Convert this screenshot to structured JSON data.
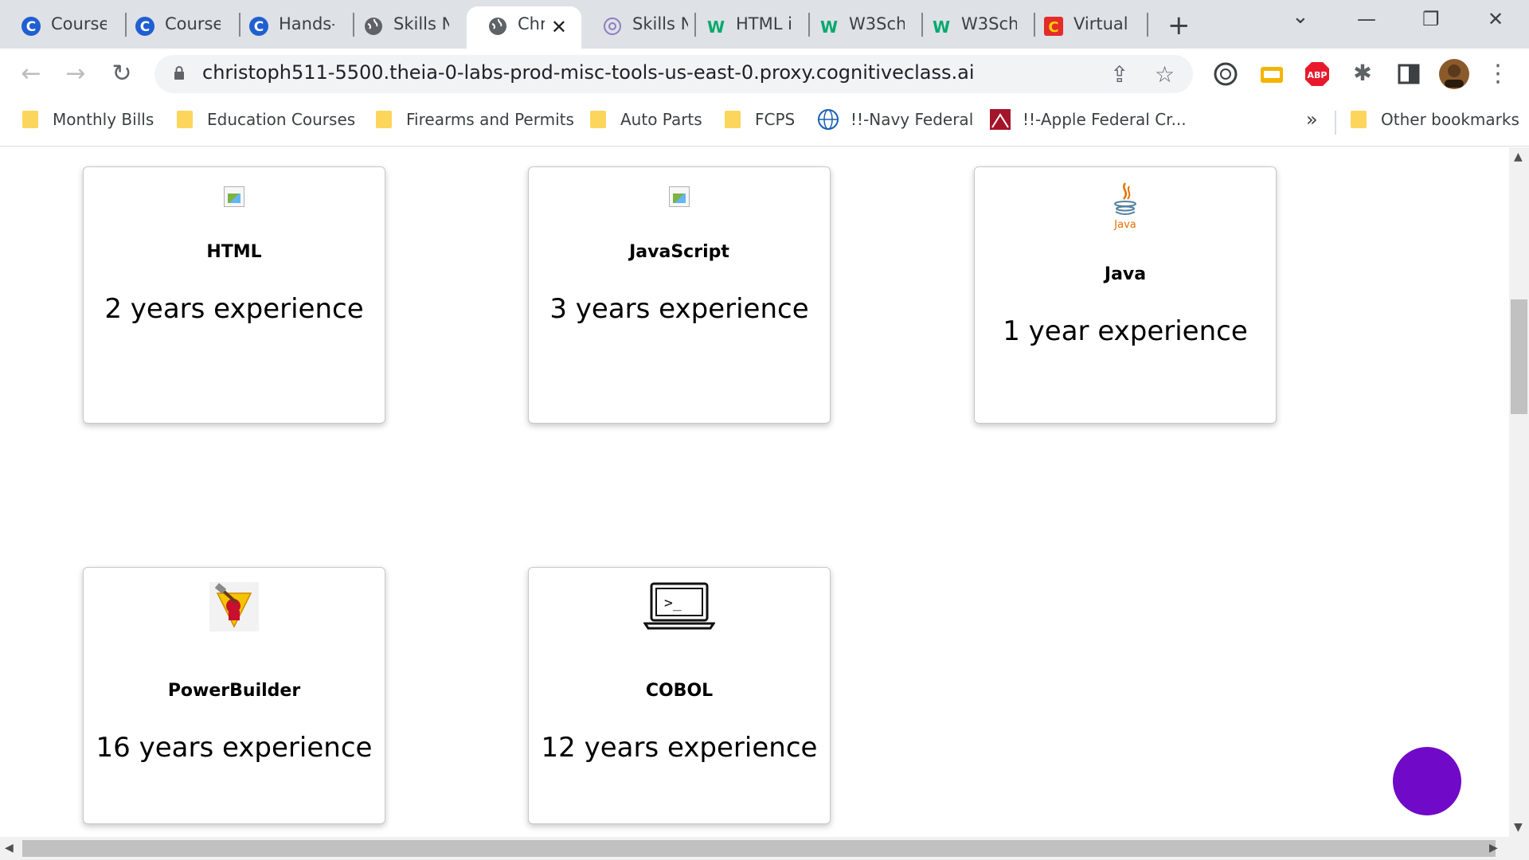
{
  "browser": {
    "tabs": [
      {
        "label": "Courser",
        "favicon": "coursera-icon",
        "color": "#1f5fd1"
      },
      {
        "label": "Courser",
        "favicon": "coursera-icon",
        "color": "#1f5fd1"
      },
      {
        "label": "Hands-",
        "favicon": "coursera-icon",
        "color": "#1f5fd1"
      },
      {
        "label": "Skills N",
        "favicon": "globe-icon",
        "color": "#5f6368"
      },
      {
        "label": "Chr",
        "favicon": "globe-icon",
        "color": "#5f6368",
        "active": true
      },
      {
        "label": "Skills N",
        "favicon": "gear-icon",
        "color": "#8e7cc3"
      },
      {
        "label": "HTML i",
        "favicon": "w3schools-icon",
        "color": "#04aa6d"
      },
      {
        "label": "W3Sch",
        "favicon": "w3schools-icon",
        "color": "#04aa6d"
      },
      {
        "label": "W3Sch",
        "favicon": "w3schools-icon",
        "color": "#04aa6d"
      },
      {
        "label": "Virtual",
        "favicon": "cognitiveclass-icon",
        "color": "#e52b2b"
      }
    ],
    "close_tab_glyph": "✕",
    "new_tab_glyph": "+",
    "window_controls": {
      "tab_search": "⌄",
      "minimize": "—",
      "restore": "❐",
      "close": "✕"
    },
    "nav": {
      "back": "←",
      "forward": "→",
      "reload": "↻"
    },
    "url": "christoph511-5500.theia-0-labs-prod-misc-tools-us-east-0.proxy.cognitiveclass.ai",
    "omnibox_icons": {
      "share": "⇪",
      "bookmark_star": "☆"
    },
    "extensions": {
      "adblock_label": "ABP",
      "puzzle": "✱",
      "menu": "⋮"
    }
  },
  "bookmarks": {
    "items": [
      {
        "label": "Monthly Bills",
        "icon": "folder-icon"
      },
      {
        "label": "Education Courses",
        "icon": "folder-icon"
      },
      {
        "label": "Firearms and Permits",
        "icon": "folder-icon"
      },
      {
        "label": "Auto Parts",
        "icon": "folder-icon"
      },
      {
        "label": "FCPS",
        "icon": "folder-icon"
      },
      {
        "label": "!!-Navy Federal",
        "icon": "globe-icon"
      },
      {
        "label": "!!-Apple Federal Cr...",
        "icon": "apple-federal-icon"
      }
    ],
    "overflow": "»",
    "other": "Other bookmarks"
  },
  "skills": [
    {
      "name": "HTML",
      "experience": "2 years experience",
      "logo": "broken-image-icon"
    },
    {
      "name": "JavaScript",
      "experience": "3 years experience",
      "logo": "broken-image-icon"
    },
    {
      "name": "Java",
      "experience": "1 year experience",
      "logo": "java-logo-icon",
      "logo_text": "Java"
    },
    {
      "name": "PowerBuilder",
      "experience": "16 years experience",
      "logo": "powerbuilder-logo-icon"
    },
    {
      "name": "COBOL",
      "experience": "12 years experience",
      "logo": "terminal-laptop-icon",
      "logo_text": ">_"
    }
  ],
  "colors": {
    "fab": "#7009c8",
    "adblock": "#e8192c"
  }
}
